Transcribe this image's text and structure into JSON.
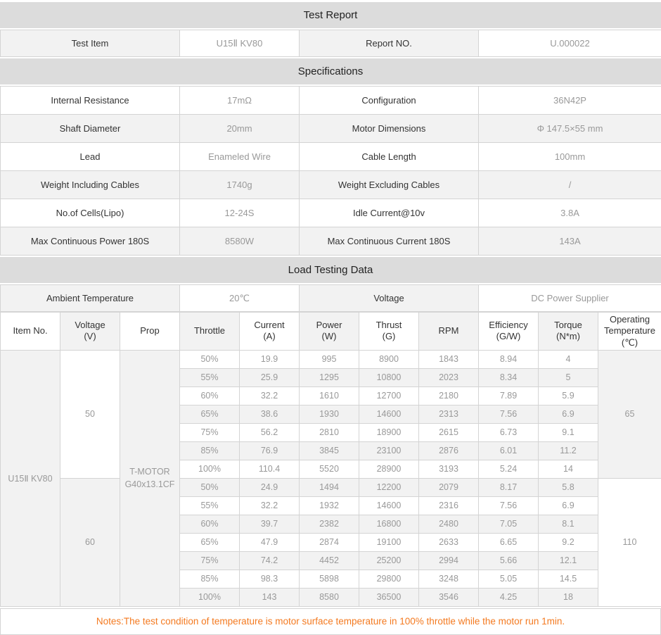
{
  "report": {
    "title": "Test Report",
    "test_item_label": "Test Item",
    "test_item_value": "U15Ⅱ KV80",
    "report_no_label": "Report NO.",
    "report_no_value": "U.000022"
  },
  "specifications": {
    "title": "Specifications",
    "rows": [
      {
        "label1": "Internal Resistance",
        "value1": "17mΩ",
        "label2": "Configuration",
        "value2": "36N42P"
      },
      {
        "label1": "Shaft Diameter",
        "value1": "20mm",
        "label2": "Motor Dimensions",
        "value2": "Φ 147.5×55 mm"
      },
      {
        "label1": "Lead",
        "value1": "Enameled Wire",
        "label2": "Cable Length",
        "value2": "100mm"
      },
      {
        "label1": "Weight Including Cables",
        "value1": "1740g",
        "label2": "Weight Excluding Cables",
        "value2": "/"
      },
      {
        "label1": "No.of Cells(Lipo)",
        "value1": "12-24S",
        "label2": "Idle Current@10v",
        "value2": "3.8A"
      },
      {
        "label1": "Max Continuous Power 180S",
        "value1": "8580W",
        "label2": "Max Continuous Current 180S",
        "value2": "143A"
      }
    ]
  },
  "load_testing": {
    "title": "Load Testing Data",
    "ambient_label": "Ambient Temperature",
    "ambient_value": "20℃",
    "voltage_label": "Voltage",
    "voltage_value": "DC Power Supplier",
    "columns": [
      "Item No.",
      "Voltage\n(V)",
      "Prop",
      "Throttle",
      "Current\n(A)",
      "Power\n(W)",
      "Thrust\n(G)",
      "RPM",
      "Efficiency\n(G/W)",
      "Torque\n(N*m)",
      "Operating\nTemperature\n(℃)"
    ],
    "item_no": "U15Ⅱ KV80",
    "prop": "T-MOTOR\nG40x13.1CF",
    "groups": [
      {
        "voltage": "50",
        "voltage_bg": "white",
        "temp": "65",
        "temp_bg": "gray",
        "rows": [
          {
            "throttle": "50%",
            "current": "19.9",
            "power": "995",
            "thrust": "8900",
            "rpm": "1843",
            "efficiency": "8.94",
            "torque": "4"
          },
          {
            "throttle": "55%",
            "current": "25.9",
            "power": "1295",
            "thrust": "10800",
            "rpm": "2023",
            "efficiency": "8.34",
            "torque": "5"
          },
          {
            "throttle": "60%",
            "current": "32.2",
            "power": "1610",
            "thrust": "12700",
            "rpm": "2180",
            "efficiency": "7.89",
            "torque": "5.9"
          },
          {
            "throttle": "65%",
            "current": "38.6",
            "power": "1930",
            "thrust": "14600",
            "rpm": "2313",
            "efficiency": "7.56",
            "torque": "6.9"
          },
          {
            "throttle": "75%",
            "current": "56.2",
            "power": "2810",
            "thrust": "18900",
            "rpm": "2615",
            "efficiency": "6.73",
            "torque": "9.1"
          },
          {
            "throttle": "85%",
            "current": "76.9",
            "power": "3845",
            "thrust": "23100",
            "rpm": "2876",
            "efficiency": "6.01",
            "torque": "11.2"
          },
          {
            "throttle": "100%",
            "current": "110.4",
            "power": "5520",
            "thrust": "28900",
            "rpm": "3193",
            "efficiency": "5.24",
            "torque": "14"
          }
        ]
      },
      {
        "voltage": "60",
        "voltage_bg": "gray",
        "temp": "110",
        "temp_bg": "white",
        "rows": [
          {
            "throttle": "50%",
            "current": "24.9",
            "power": "1494",
            "thrust": "12200",
            "rpm": "2079",
            "efficiency": "8.17",
            "torque": "5.8"
          },
          {
            "throttle": "55%",
            "current": "32.2",
            "power": "1932",
            "thrust": "14600",
            "rpm": "2316",
            "efficiency": "7.56",
            "torque": "6.9"
          },
          {
            "throttle": "60%",
            "current": "39.7",
            "power": "2382",
            "thrust": "16800",
            "rpm": "2480",
            "efficiency": "7.05",
            "torque": "8.1"
          },
          {
            "throttle": "65%",
            "current": "47.9",
            "power": "2874",
            "thrust": "19100",
            "rpm": "2633",
            "efficiency": "6.65",
            "torque": "9.2"
          },
          {
            "throttle": "75%",
            "current": "74.2",
            "power": "4452",
            "thrust": "25200",
            "rpm": "2994",
            "efficiency": "5.66",
            "torque": "12.1"
          },
          {
            "throttle": "85%",
            "current": "98.3",
            "power": "5898",
            "thrust": "29800",
            "rpm": "3248",
            "efficiency": "5.05",
            "torque": "14.5"
          },
          {
            "throttle": "100%",
            "current": "143",
            "power": "8580",
            "thrust": "36500",
            "rpm": "3546",
            "efficiency": "4.25",
            "torque": "18"
          }
        ]
      }
    ]
  },
  "notes": "Notes:The test condition of temperature is motor surface temperature in 100% throttle while the motor run 1min.",
  "colors": {
    "section_bar_bg": "#dcdcdc",
    "stripe_bg": "#f2f2f2",
    "border": "#d4d4d4",
    "label_text": "#333333",
    "value_text": "#999999",
    "notes_text": "#f47a20"
  }
}
